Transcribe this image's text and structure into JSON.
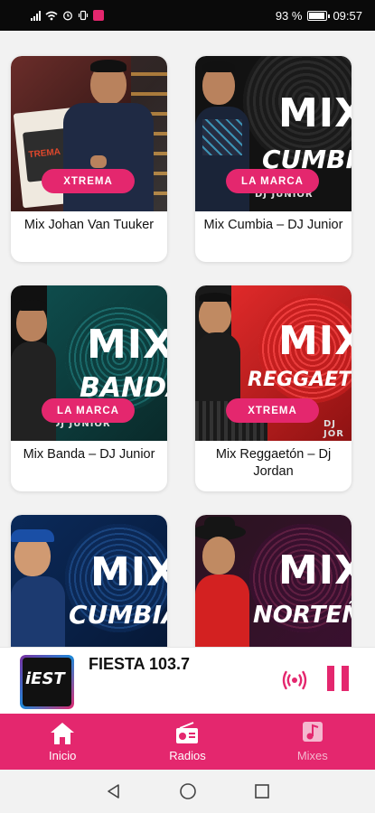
{
  "status_bar": {
    "battery": "93 %",
    "time": "09:57"
  },
  "mixes": [
    {
      "title": "Mix Johan Van Tuuker",
      "badge": "XTREMA",
      "badge_color": "#e4276e"
    },
    {
      "title": "Mix Cumbia – DJ Junior",
      "badge": "LA MARCA",
      "badge_color": "#e4276e",
      "art_text": "MIX",
      "art_sub": "CUMBIA",
      "art_dj": "DJ JUNIOR"
    },
    {
      "title": "Mix Banda – DJ Junior",
      "badge": "LA MARCA",
      "badge_color": "#e4276e",
      "art_text": "MIX",
      "art_sub": "BANDA",
      "art_dj": "DJ JUNIOR"
    },
    {
      "title": "Mix Reggaetón – Dj Jordan",
      "badge": "XTREMA",
      "badge_color": "#e4276e",
      "art_text": "MIX",
      "art_sub": "REGGAETON",
      "art_dj": "DJ JOR"
    },
    {
      "title": "",
      "badge": "",
      "art_text": "MIX",
      "art_sub": "CUMBIA"
    },
    {
      "title": "",
      "badge": "",
      "art_text": "MIX",
      "art_sub": "NORTEÑO"
    }
  ],
  "player": {
    "station": "FIESTA 103.7",
    "logo_text": "iEST",
    "icons": [
      "broadcast-icon",
      "pause-icon"
    ]
  },
  "nav": {
    "items": [
      {
        "label": "Inicio",
        "icon": "home-icon"
      },
      {
        "label": "Radios",
        "icon": "radio-icon"
      },
      {
        "label": "Mixes",
        "icon": "music-note-icon",
        "active": true
      }
    ]
  },
  "colors": {
    "accent": "#e4276e",
    "active_nav": "#f4b8cf"
  }
}
